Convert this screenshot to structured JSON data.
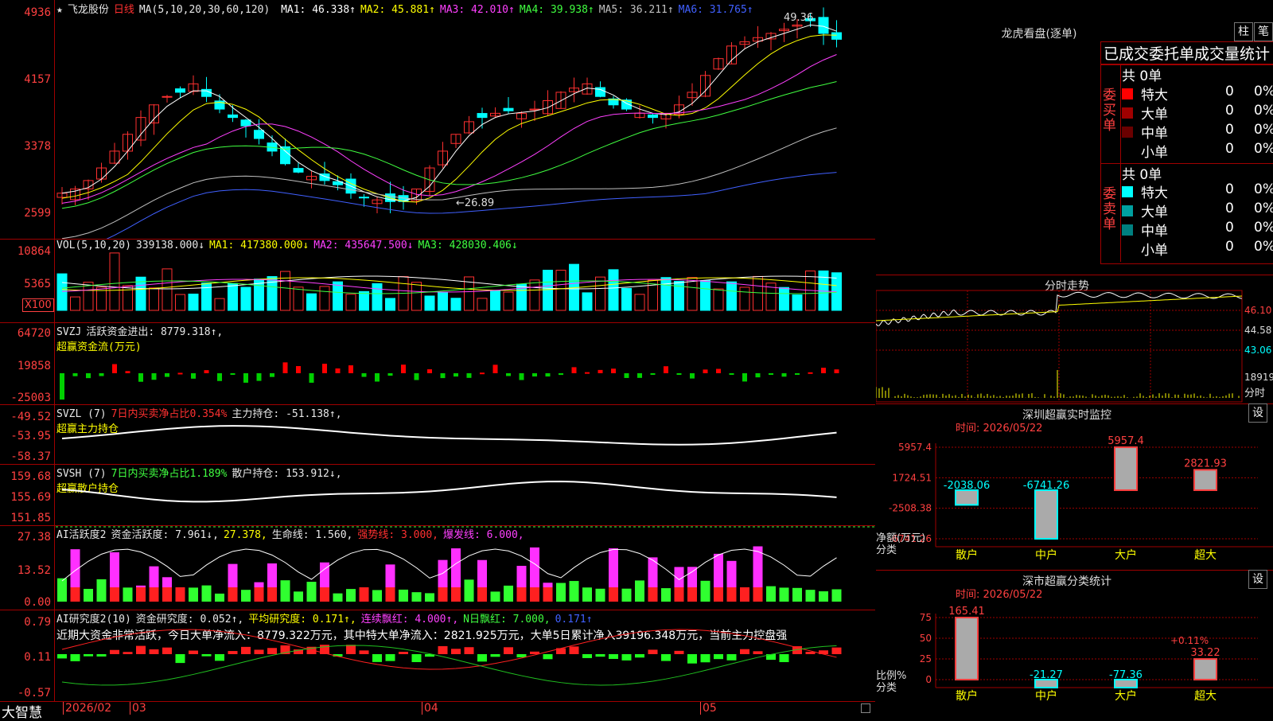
{
  "stock": {
    "star": "★",
    "name": "飞龙股份",
    "period": "日线"
  },
  "main": {
    "ma_label": "MA(5,10,20,30,60,120)",
    "ma": [
      {
        "name": "MA1",
        "value": "46.338↑",
        "color": "#ffffff"
      },
      {
        "name": "MA2",
        "value": "45.881↑",
        "color": "#ffff00"
      },
      {
        "name": "MA3",
        "value": "42.010↑",
        "color": "#ff40ff"
      },
      {
        "name": "MA4",
        "value": "39.938↑",
        "color": "#40ff40"
      },
      {
        "name": "MA5",
        "value": "36.211↑",
        "color": "#c0c0c0"
      },
      {
        "name": "MA6",
        "value": "31.765↑",
        "color": "#4060ff"
      }
    ],
    "yticks": [
      "4936",
      "4157",
      "3378",
      "2599"
    ],
    "high_label": "49.36",
    "low_label": "←26.89"
  },
  "vol": {
    "label": "VOL(5,10,20)",
    "value": "339138.000↓",
    "ma1": "MA1: 417380.000↓",
    "ma2": "MA2: 435647.500↓",
    "ma3": "MA3: 428030.406↓",
    "yticks": [
      "10864",
      "5365"
    ],
    "unit": "X100"
  },
  "svzj": {
    "label": "SVZJ",
    "text": "活跃资金进出: 8779.318↑,",
    "sub": "超赢资金流(万元)",
    "yticks": [
      "64720",
      "19858",
      "-25003"
    ]
  },
  "svzl": {
    "label": "SVZL (7)",
    "text1": "7日内买卖净占比0.354%",
    "text2": "主力持仓: -51.138↑,",
    "sub": "超赢主力持仓",
    "yticks": [
      "-49.52",
      "-53.95",
      "-58.37"
    ]
  },
  "svsh": {
    "label": "SVSH (7)",
    "text1": "7日内买卖净占比1.189%",
    "text2": "散户持仓: 153.912↓,",
    "sub": "超赢散户持仓",
    "yticks": [
      "159.68",
      "155.69",
      "151.85"
    ]
  },
  "ai1": {
    "label": "AI活跃度2",
    "t1": "资金活跃度: 7.961↓,",
    "t2": "27.378,",
    "t3": "生命线: 1.560,",
    "t4": "强势线: 3.000,",
    "t5": "爆发线: 6.000,",
    "yticks": [
      "27.38",
      "13.52",
      "0.00"
    ]
  },
  "ai2": {
    "label": "AI研究度2(10)",
    "t1": "资金研究度: 0.052↑,",
    "t2": "平均研究度: 0.171↑,",
    "t3": "连续飘红: 4.000↑,",
    "t4": "N日飘红: 7.000,",
    "t5": "0.171↑",
    "comment": "近期大资金非常活跃，今日大单净流入：8779.322万元，其中特大单净流入：2821.925万元，大单5日累计净入39196.348万元，当前主力控盘强",
    "yticks": [
      "0.79",
      "0.11",
      "-0.57"
    ]
  },
  "bottom": {
    "brand": "大智慧",
    "dates": [
      "2026/02",
      "03",
      "04",
      "05"
    ]
  },
  "longhu": {
    "title": "龙虎看盘(逐单)",
    "btn1": "柱",
    "btn2": "笔",
    "tabs": "已成交委托单成交量统计",
    "buy_label": "委买单",
    "sell_label": "委卖单",
    "buy_total": "共 0单",
    "sell_total": "共 0单",
    "buy_rows": [
      {
        "name": "特大",
        "v": "0",
        "p": "0%",
        "c": "#ff0000"
      },
      {
        "name": "大单",
        "v": "0",
        "p": "0%",
        "c": "#a00000"
      },
      {
        "name": "中单",
        "v": "0",
        "p": "0%",
        "c": "#6a0000"
      },
      {
        "name": "小单",
        "v": "0",
        "p": "0%",
        "c": ""
      }
    ],
    "sell_rows": [
      {
        "name": "特大",
        "v": "0",
        "p": "0%",
        "c": "#00ffff"
      },
      {
        "name": "大单",
        "v": "0",
        "p": "0%",
        "c": "#00a0a0"
      },
      {
        "name": "中单",
        "v": "0",
        "p": "0%",
        "c": "#008080"
      },
      {
        "name": "小单",
        "v": "0",
        "p": "0%",
        "c": ""
      }
    ]
  },
  "intraday": {
    "title": "分时走势",
    "ticks": [
      "46.10",
      "44.58",
      "43.06"
    ],
    "vol_tick": "18919",
    "foot": "分时"
  },
  "monitor": {
    "title": "深圳超赢实时监控",
    "btn": "设",
    "time": "时间: 2026/05/22",
    "yticks": [
      "5957.4",
      "1724.51",
      "-2508.38",
      "-6741.26"
    ],
    "ylabel": "净额(万元)",
    "xlabel": "分类",
    "categories": [
      "散户",
      "中户",
      "大户",
      "超大"
    ],
    "values": [
      -2038.06,
      -6741.26,
      5957.4,
      2821.93
    ],
    "value_labels": [
      "-2038.06",
      "-6741.26",
      "5957.4",
      "2821.93"
    ]
  },
  "classify": {
    "title": "深市超赢分类统计",
    "btn": "设",
    "time": "时间: 2026/05/22",
    "yticks": [
      "75",
      "50",
      "25",
      "0"
    ],
    "ylabel": "比例%",
    "xlabel": "分类",
    "categories": [
      "散户",
      "中户",
      "大户",
      "超大"
    ],
    "values": [
      165.41,
      -21.27,
      -77.36,
      33.22
    ],
    "value_labels": [
      "165.41",
      "-21.27",
      "-77.36",
      "33.22"
    ],
    "extra": "+0.11%"
  }
}
